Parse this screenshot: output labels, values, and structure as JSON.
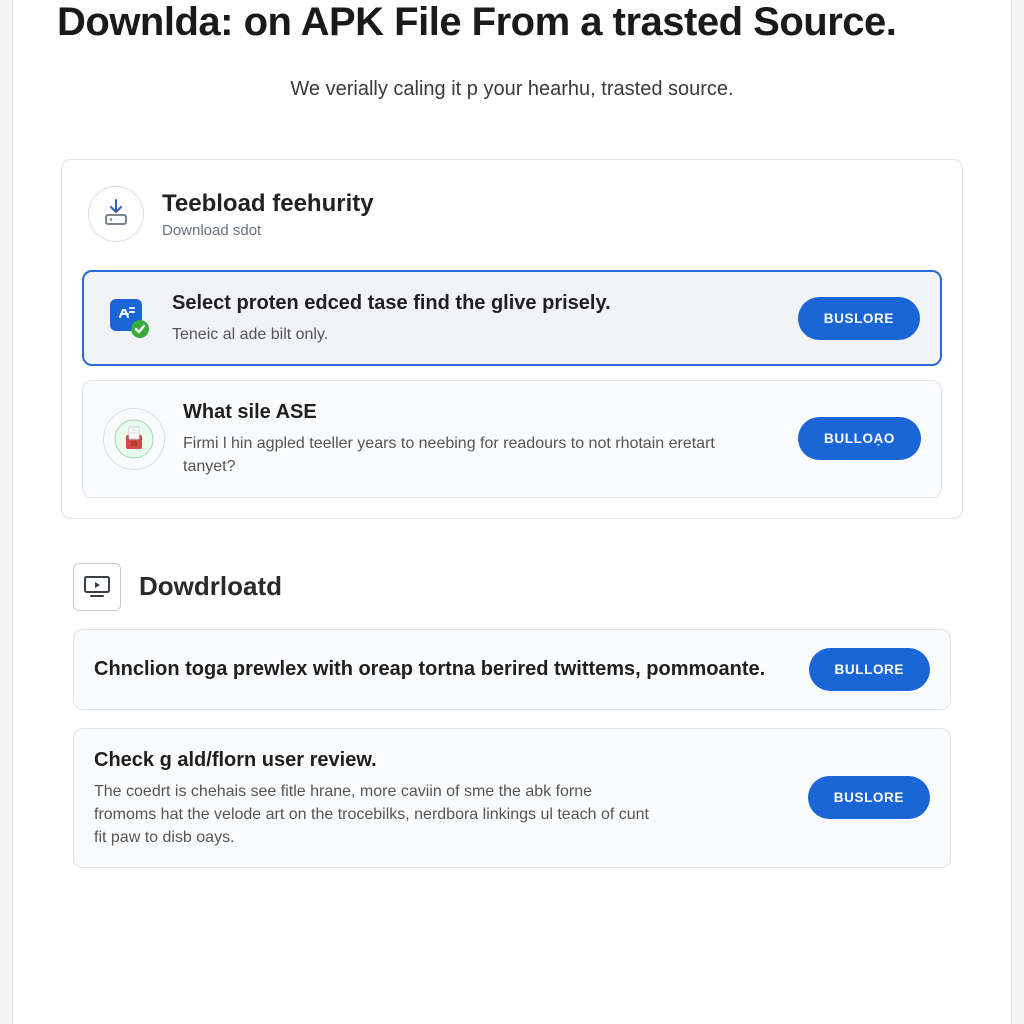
{
  "header": {
    "title": "Downlda: on APK File From a trasted Source.",
    "subtitle": "We verially caling it p your hearhu, trasted source."
  },
  "panel1": {
    "title": "Teebload feehurity",
    "subtitle": "Download sdot",
    "rows": [
      {
        "title": "Select proten edced tase find the glive prisely.",
        "desc": "Teneic al ade bilt only.",
        "button": "BUSLORE"
      },
      {
        "title": "What sile ASE",
        "desc": "Firmi l hin agpled teeller years to neebing for readours to not rhotain eretart tanyet?",
        "button": "BULLOẠO"
      }
    ]
  },
  "section2": {
    "title": "Dowdrloatd",
    "rows": [
      {
        "title": "Chnclion toga prewlex with oreap tortna berired twittems, pommoante.",
        "desc": "",
        "button": "BULLORE"
      },
      {
        "title": "Check g ald/florn user review.",
        "desc": "The coedrt is chehais see fitle hrane, more caviin of sme the abk forne fromoms hat the velode art on the trocebilks, nerdbora linkings ul teach of cunt fit paw to disb oays.",
        "button": "BUSLORE"
      }
    ]
  }
}
